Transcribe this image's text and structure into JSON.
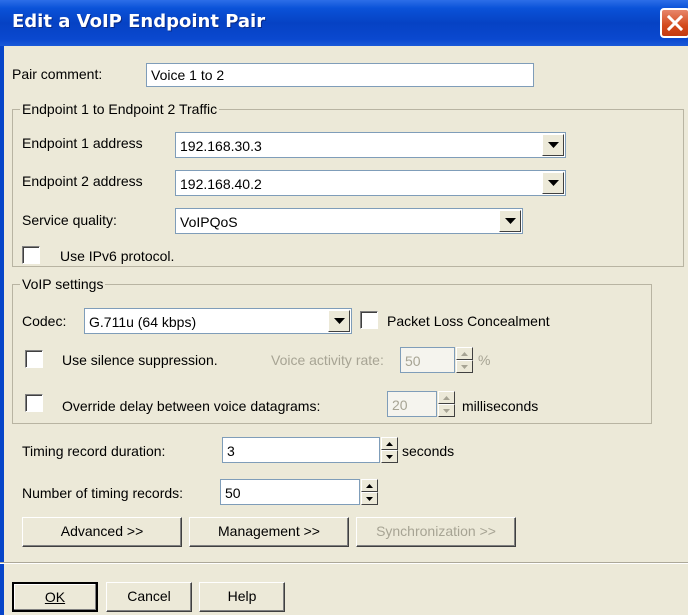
{
  "window": {
    "title": "Edit a VoIP Endpoint Pair"
  },
  "pair_comment": {
    "label": "Pair comment:",
    "value": "Voice 1 to 2"
  },
  "traffic_group": {
    "legend": "Endpoint 1 to Endpoint 2 Traffic",
    "endpoint1": {
      "label": "Endpoint 1 address",
      "value": "192.168.30.3"
    },
    "endpoint2": {
      "label": "Endpoint 2 address",
      "value": "192.168.40.2"
    },
    "service_quality": {
      "label": "Service quality:",
      "value": "VoIPQoS"
    },
    "ipv6": {
      "label": "Use IPv6 protocol.",
      "checked": false
    }
  },
  "voip_group": {
    "legend": "VoIP settings",
    "codec": {
      "label": "Codec:",
      "value": "G.711u (64 kbps)"
    },
    "plc": {
      "label": "Packet Loss Concealment",
      "checked": false
    },
    "silence": {
      "label": "Use silence suppression.",
      "checked": false,
      "rate_label": "Voice activity rate:",
      "rate_value": "50",
      "rate_unit": "%"
    },
    "override_delay": {
      "label": "Override delay between voice datagrams:",
      "checked": false,
      "value": "20",
      "unit": "milliseconds"
    }
  },
  "timing_duration": {
    "label": "Timing record duration:",
    "value": "3",
    "unit": "seconds"
  },
  "timing_records": {
    "label": "Number of timing records:",
    "value": "50"
  },
  "buttons": {
    "advanced": "Advanced >>",
    "management": "Management >>",
    "synchronization": "Synchronization >>",
    "ok": "OK",
    "cancel": "Cancel",
    "help": "Help"
  },
  "colors": {
    "titlebar": "#0a48cf",
    "dialog_bg": "#ece9d8",
    "close_button": "#d44a1c"
  },
  "icons": {
    "close": "close-icon",
    "dropdown": "chevron-down-icon",
    "spin_up": "arrow-up-icon",
    "spin_down": "arrow-down-icon"
  }
}
